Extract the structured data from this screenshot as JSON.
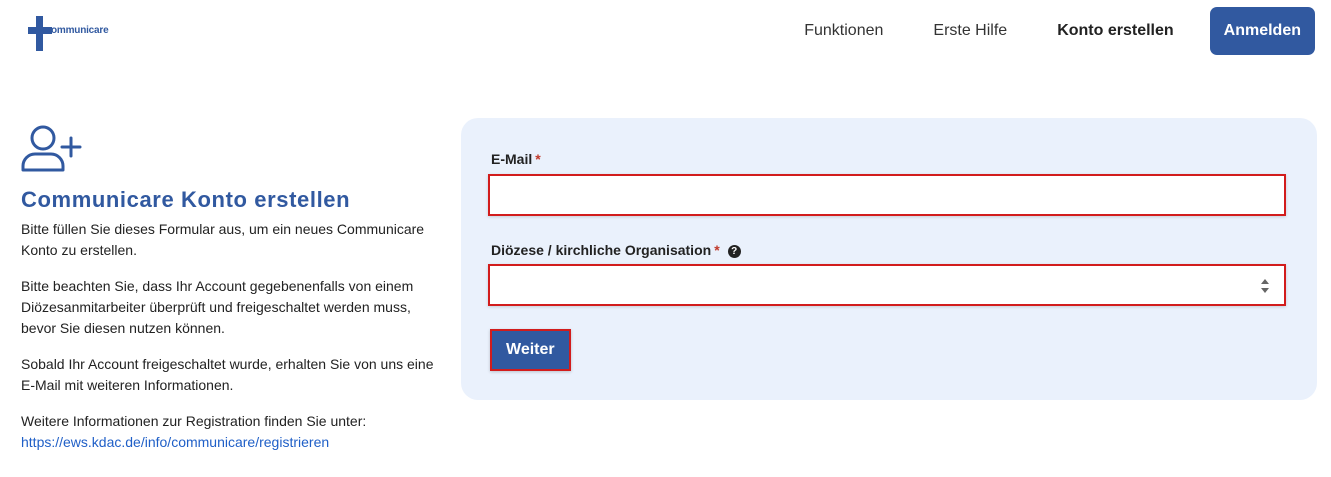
{
  "header": {
    "logo_text": "ommunicare",
    "nav": [
      {
        "label": "Funktionen"
      },
      {
        "label": "Erste Hilfe"
      },
      {
        "label": "Konto erstellen"
      }
    ],
    "login_label": "Anmelden"
  },
  "intro": {
    "icon": "user-plus-icon",
    "title": "Communicare Konto erstellen",
    "paragraphs": [
      "Bitte füllen Sie dieses Formular aus, um ein neues Communicare Konto zu erstellen.",
      "Bitte beachten Sie, dass Ihr Account gegebenenfalls von einem Diözesanmitarbeiter überprüft und freigeschaltet werden muss, bevor Sie diesen nutzen können.",
      "Sobald Ihr Account freigeschaltet wurde, erhalten Sie von uns eine E-Mail mit weiteren Informationen.",
      "Weitere Informationen zur Registration finden Sie unter:"
    ],
    "link": "https://ews.kdac.de/info/communicare/registrieren"
  },
  "form": {
    "email_label": "E-Mail",
    "email_value": "",
    "org_label": "Diözese / kirchliche Organisation",
    "org_value": "",
    "required_mark": "*",
    "help_glyph": "?",
    "submit_label": "Weiter"
  },
  "colors": {
    "brand": "#3159a0",
    "card_bg": "#eaf1fc",
    "error_border": "#d21c1c"
  }
}
